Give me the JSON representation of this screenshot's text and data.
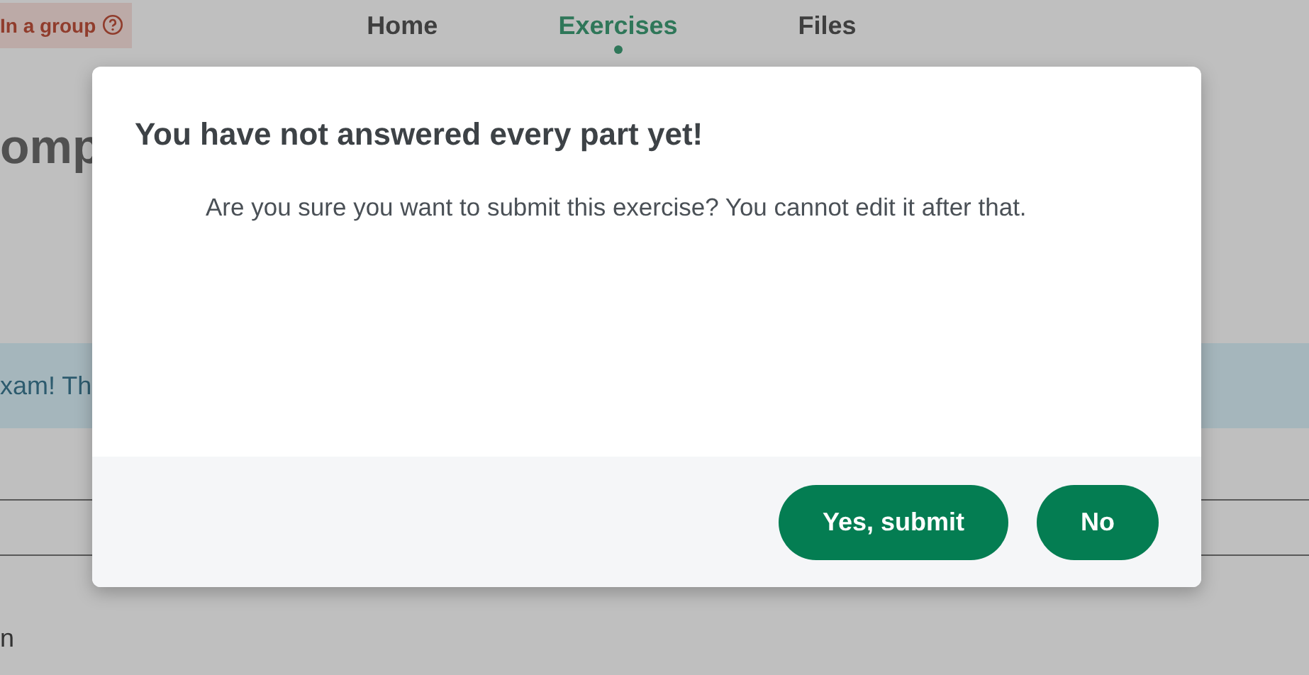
{
  "nav": {
    "badge": "In a group",
    "tabs": [
      {
        "label": "Home",
        "selected": false
      },
      {
        "label": "Exercises",
        "selected": true
      },
      {
        "label": "Files",
        "selected": false
      }
    ]
  },
  "page": {
    "heading": "omp",
    "banner": "xam! Th",
    "footer_text": "n"
  },
  "dialog": {
    "title": "You have not answered every part yet!",
    "message": "Are you sure you want to submit this exercise? You cannot edit it after that.",
    "buttons": [
      {
        "label": "Yes, submit"
      },
      {
        "label": "No"
      }
    ]
  }
}
